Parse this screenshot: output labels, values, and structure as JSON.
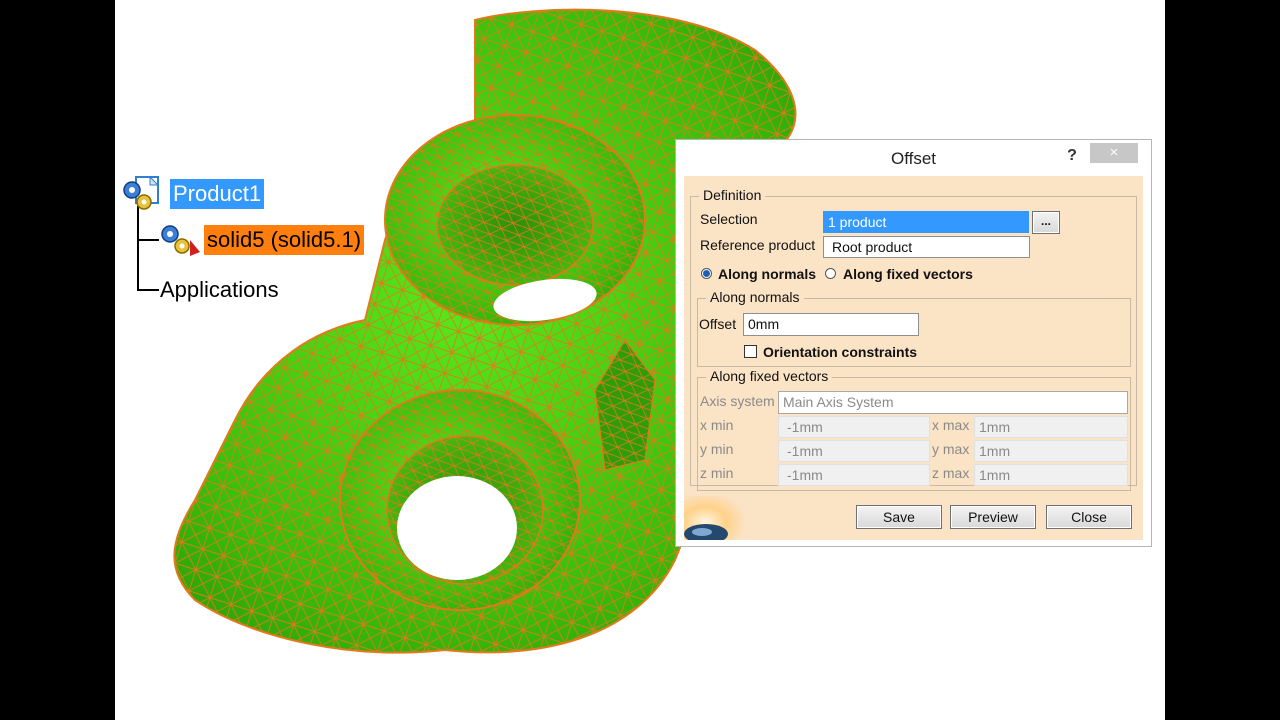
{
  "tree": {
    "root_label": "Product1",
    "child_label": "solid5 (solid5.1)",
    "applications_label": "Applications",
    "root_icon": "product-assembly-icon",
    "child_icon": "part-gears-icon"
  },
  "dialog": {
    "title": "Offset",
    "help_label": "?",
    "close_label": "×",
    "definition": {
      "legend": "Definition",
      "selection_label": "Selection",
      "selection_value": "1 product",
      "browse_label": "...",
      "reference_label": "Reference product",
      "reference_value": "Root product",
      "mode_normals_label": "Along normals",
      "mode_vectors_label": "Along fixed vectors",
      "selected_mode": "Along normals"
    },
    "along_normals": {
      "legend": "Along normals",
      "offset_label": "Offset",
      "offset_value": "0mm",
      "orientation_label": "Orientation constraints",
      "orientation_checked": false
    },
    "along_fixed_vectors": {
      "legend": "Along fixed vectors",
      "axis_label": "Axis system",
      "axis_value": "Main Axis System",
      "xmin_label": "x min",
      "xmin_value": "-1mm",
      "xmax_label": "x max",
      "xmax_value": "1mm",
      "ymin_label": "y min",
      "ymin_value": "-1mm",
      "ymax_label": "y max",
      "ymax_value": "1mm",
      "zmin_label": "z min",
      "zmin_value": "-1mm",
      "zmax_label": "z max",
      "zmax_value": "1mm"
    },
    "buttons": {
      "save": "Save",
      "preview": "Preview",
      "close": "Close"
    }
  },
  "colors": {
    "mesh_fill": "#3fc40a",
    "mesh_edges": "#e07a1a",
    "selection_blue": "#3399ff",
    "selection_orange": "#ff7f0e",
    "dialog_body": "#fbe3c6"
  }
}
